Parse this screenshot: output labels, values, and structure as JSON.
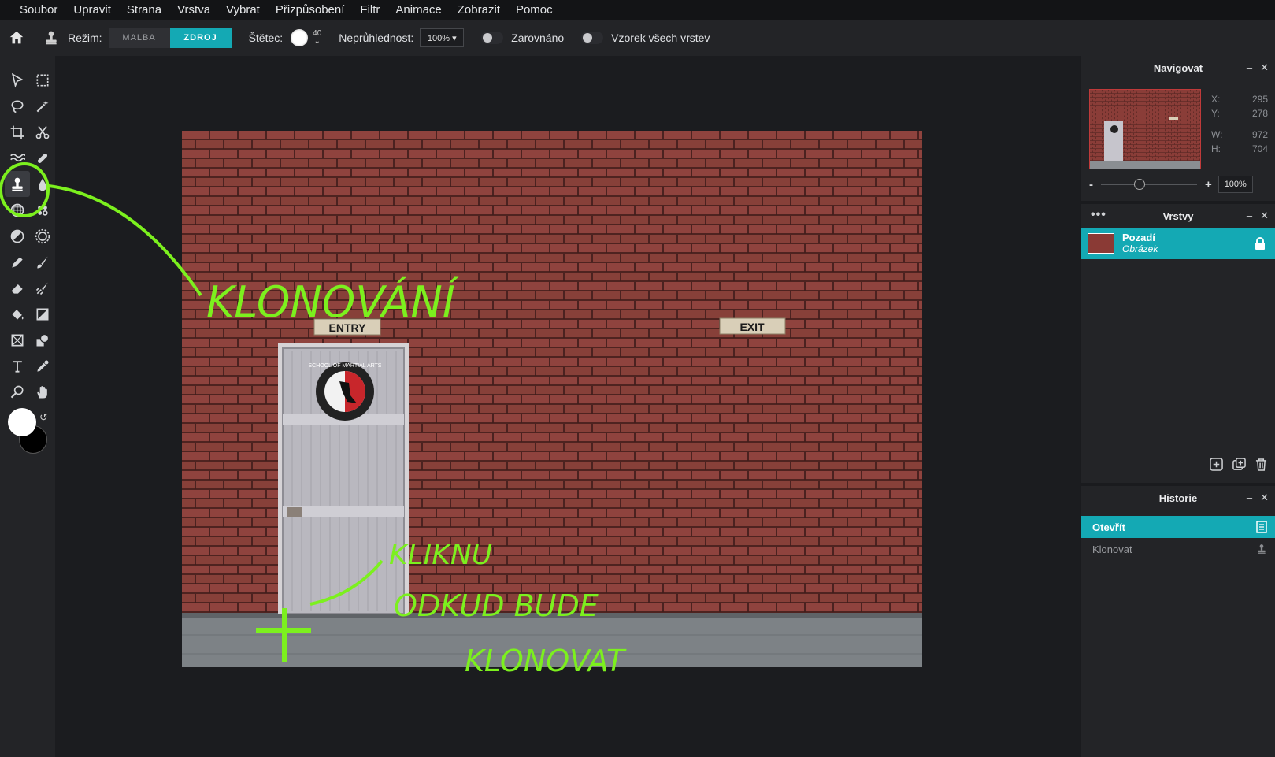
{
  "menu": {
    "items": [
      "Soubor",
      "Upravit",
      "Strana",
      "Vrstva",
      "Vybrat",
      "Přizpůsobení",
      "Filtr",
      "Animace",
      "Zobrazit",
      "Pomoc"
    ]
  },
  "options": {
    "mode_label": "Režim:",
    "mode_paint": "MALBA",
    "mode_source": "ZDROJ",
    "brush_label": "Štětec:",
    "brush_size": "40",
    "opacity_label": "Neprůhlednost:",
    "opacity_value": "100% ▾",
    "aligned_label": "Zarovnáno",
    "sample_all_label": "Vzorek všech vrstev"
  },
  "colors": {
    "accent": "#14a9b4",
    "annotation": "#7cf01e",
    "foreground": "#ffffff",
    "background": "#000000"
  },
  "navigator": {
    "title": "Navigovat",
    "x_label": "X:",
    "x_value": "295",
    "y_label": "Y:",
    "y_value": "278",
    "w_label": "W:",
    "w_value": "972",
    "h_label": "H:",
    "h_value": "704",
    "zoom_minus": "-",
    "zoom_plus": "+",
    "zoom_value": "100%"
  },
  "layers": {
    "title": "Vrstvy",
    "dots": "•••",
    "items": [
      {
        "name": "Pozadí",
        "type": "Obrázek"
      }
    ]
  },
  "history": {
    "title": "Historie",
    "items": [
      "Otevřít",
      "Klonovat"
    ]
  },
  "panel_ctrl": {
    "minimize": "–",
    "close": "✕"
  },
  "canvas": {
    "sign_entry": "ENTRY",
    "sign_exit": "EXIT",
    "logo_text": "SCHOOL OF MARTIAL ARTS",
    "annotation_title": "KLONOVÁNÍ",
    "annotation_line1": "KLIKNU",
    "annotation_line2": "ODKUD BUDE",
    "annotation_line3": "KLONOVAT"
  }
}
